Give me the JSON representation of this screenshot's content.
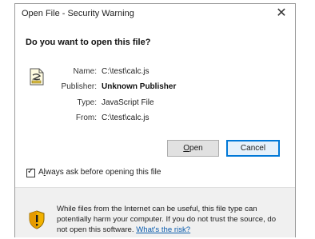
{
  "window": {
    "title": "Open File - Security Warning",
    "close_glyph": "✕"
  },
  "heading": "Do you want to open this file?",
  "file_icon": "javascript-file-icon",
  "details": [
    {
      "label": "Name:",
      "value": "C:\\test\\calc.js",
      "bold": false
    },
    {
      "label": "Publisher:",
      "value": "Unknown Publisher",
      "bold": true
    },
    {
      "label": "Type:",
      "value": "JavaScript File",
      "bold": false
    },
    {
      "label": "From:",
      "value": "C:\\test\\calc.js",
      "bold": false
    }
  ],
  "buttons": {
    "open_mnemonic": "O",
    "open_rest": "pen",
    "cancel_label": "Cancel"
  },
  "checkbox": {
    "checked": true,
    "mnemonic": "l",
    "label_pre": "A",
    "label_rest": "ways ask before opening this file",
    "check_glyph": "✓"
  },
  "warning": {
    "icon": "shield-warning-icon",
    "text": "While files from the Internet can be useful, this file type can potentially harm your computer. If you do not trust the source, do not open this software.",
    "link": "What's the risk?"
  },
  "colors": {
    "accent": "#0078d7",
    "link": "#0b5cad",
    "footer_bg": "#f0f0f0"
  }
}
